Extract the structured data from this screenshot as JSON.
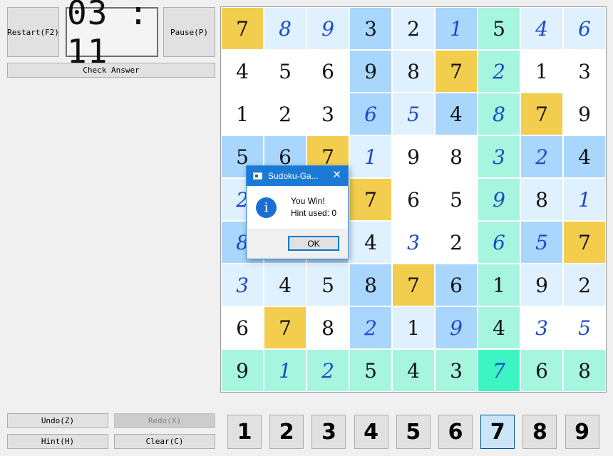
{
  "toolbar": {
    "restart_label": "Restart(F2)",
    "pause_label": "Pause(P)",
    "check_label": "Check Answer",
    "timer": "03 : 11"
  },
  "actions": {
    "undo_label": "Undo(Z)",
    "redo_label": "Redo(X)",
    "hint_label": "Hint(H)",
    "clear_label": "Clear(C)"
  },
  "board": {
    "rows": [
      [
        {
          "v": "7",
          "bg": "#f2cd4e",
          "u": 0
        },
        {
          "v": "8",
          "bg": "#dff0ff",
          "u": 1
        },
        {
          "v": "9",
          "bg": "#dff0ff",
          "u": 1
        },
        {
          "v": "3",
          "bg": "#a8d6fc",
          "u": 0
        },
        {
          "v": "2",
          "bg": "#dff0ff",
          "u": 0
        },
        {
          "v": "1",
          "bg": "#a8d6fc",
          "u": 1
        },
        {
          "v": "5",
          "bg": "#a6f5de",
          "u": 0
        },
        {
          "v": "4",
          "bg": "#dff0ff",
          "u": 1
        },
        {
          "v": "6",
          "bg": "#dff0ff",
          "u": 1
        }
      ],
      [
        {
          "v": "4",
          "bg": "#ffffff",
          "u": 0
        },
        {
          "v": "5",
          "bg": "#ffffff",
          "u": 0
        },
        {
          "v": "6",
          "bg": "#ffffff",
          "u": 0
        },
        {
          "v": "9",
          "bg": "#a8d6fc",
          "u": 0
        },
        {
          "v": "8",
          "bg": "#dff0ff",
          "u": 0
        },
        {
          "v": "7",
          "bg": "#f2cd4e",
          "u": 0
        },
        {
          "v": "2",
          "bg": "#a6f5de",
          "u": 1
        },
        {
          "v": "1",
          "bg": "#ffffff",
          "u": 0
        },
        {
          "v": "3",
          "bg": "#ffffff",
          "u": 0
        }
      ],
      [
        {
          "v": "1",
          "bg": "#ffffff",
          "u": 0
        },
        {
          "v": "2",
          "bg": "#ffffff",
          "u": 0
        },
        {
          "v": "3",
          "bg": "#ffffff",
          "u": 0
        },
        {
          "v": "6",
          "bg": "#a8d6fc",
          "u": 1
        },
        {
          "v": "5",
          "bg": "#dff0ff",
          "u": 1
        },
        {
          "v": "4",
          "bg": "#a8d6fc",
          "u": 0
        },
        {
          "v": "8",
          "bg": "#a6f5de",
          "u": 1
        },
        {
          "v": "7",
          "bg": "#f2cd4e",
          "u": 0
        },
        {
          "v": "9",
          "bg": "#ffffff",
          "u": 0
        }
      ],
      [
        {
          "v": "5",
          "bg": "#a8d6fc",
          "u": 0
        },
        {
          "v": "6",
          "bg": "#a8d6fc",
          "u": 0
        },
        {
          "v": "7",
          "bg": "#f2cd4e",
          "u": 0
        },
        {
          "v": "1",
          "bg": "#dff0ff",
          "u": 1
        },
        {
          "v": "9",
          "bg": "#ffffff",
          "u": 0
        },
        {
          "v": "8",
          "bg": "#ffffff",
          "u": 0
        },
        {
          "v": "3",
          "bg": "#a6f5de",
          "u": 1
        },
        {
          "v": "2",
          "bg": "#a8d6fc",
          "u": 1
        },
        {
          "v": "4",
          "bg": "#a8d6fc",
          "u": 0
        }
      ],
      [
        {
          "v": "2",
          "bg": "#dff0ff",
          "u": 1
        },
        {
          "v": "",
          "bg": "#dff0ff",
          "u": 0
        },
        {
          "v": "",
          "bg": "#dff0ff",
          "u": 0
        },
        {
          "v": "7",
          "bg": "#f2cd4e",
          "u": 0
        },
        {
          "v": "6",
          "bg": "#ffffff",
          "u": 0
        },
        {
          "v": "5",
          "bg": "#ffffff",
          "u": 0
        },
        {
          "v": "9",
          "bg": "#a6f5de",
          "u": 1
        },
        {
          "v": "8",
          "bg": "#dff0ff",
          "u": 0
        },
        {
          "v": "1",
          "bg": "#dff0ff",
          "u": 1
        }
      ],
      [
        {
          "v": "8",
          "bg": "#a8d6fc",
          "u": 1
        },
        {
          "v": "",
          "bg": "#a8d6fc",
          "u": 0
        },
        {
          "v": "",
          "bg": "#a8d6fc",
          "u": 0
        },
        {
          "v": "4",
          "bg": "#dff0ff",
          "u": 0
        },
        {
          "v": "3",
          "bg": "#ffffff",
          "u": 1
        },
        {
          "v": "2",
          "bg": "#ffffff",
          "u": 0
        },
        {
          "v": "6",
          "bg": "#a6f5de",
          "u": 1
        },
        {
          "v": "5",
          "bg": "#a8d6fc",
          "u": 1
        },
        {
          "v": "7",
          "bg": "#f2cd4e",
          "u": 0
        }
      ],
      [
        {
          "v": "3",
          "bg": "#dff0ff",
          "u": 1
        },
        {
          "v": "4",
          "bg": "#dff0ff",
          "u": 0
        },
        {
          "v": "5",
          "bg": "#dff0ff",
          "u": 0
        },
        {
          "v": "8",
          "bg": "#a8d6fc",
          "u": 0
        },
        {
          "v": "7",
          "bg": "#f2cd4e",
          "u": 0
        },
        {
          "v": "6",
          "bg": "#a8d6fc",
          "u": 0
        },
        {
          "v": "1",
          "bg": "#a6f5de",
          "u": 0
        },
        {
          "v": "9",
          "bg": "#dff0ff",
          "u": 0
        },
        {
          "v": "2",
          "bg": "#dff0ff",
          "u": 0
        }
      ],
      [
        {
          "v": "6",
          "bg": "#ffffff",
          "u": 0
        },
        {
          "v": "7",
          "bg": "#f2cd4e",
          "u": 0
        },
        {
          "v": "8",
          "bg": "#ffffff",
          "u": 0
        },
        {
          "v": "2",
          "bg": "#a8d6fc",
          "u": 1
        },
        {
          "v": "1",
          "bg": "#dff0ff",
          "u": 0
        },
        {
          "v": "9",
          "bg": "#a8d6fc",
          "u": 1
        },
        {
          "v": "4",
          "bg": "#a6f5de",
          "u": 0
        },
        {
          "v": "3",
          "bg": "#ffffff",
          "u": 1
        },
        {
          "v": "5",
          "bg": "#ffffff",
          "u": 1
        }
      ],
      [
        {
          "v": "9",
          "bg": "#a6f5de",
          "u": 0
        },
        {
          "v": "1",
          "bg": "#a6f5de",
          "u": 1
        },
        {
          "v": "2",
          "bg": "#a6f5de",
          "u": 1
        },
        {
          "v": "5",
          "bg": "#a6f5de",
          "u": 0
        },
        {
          "v": "4",
          "bg": "#a6f5de",
          "u": 0
        },
        {
          "v": "3",
          "bg": "#a6f5de",
          "u": 0
        },
        {
          "v": "7",
          "bg": "#3df5c2",
          "u": 1
        },
        {
          "v": "6",
          "bg": "#a6f5de",
          "u": 0
        },
        {
          "v": "8",
          "bg": "#a6f5de",
          "u": 0
        }
      ]
    ]
  },
  "numpad": {
    "buttons": [
      "1",
      "2",
      "3",
      "4",
      "5",
      "6",
      "7",
      "8",
      "9"
    ],
    "selected": "7"
  },
  "dialog": {
    "title": "Sudoku-Ga...",
    "line1": "You Win!",
    "line2": "Hint used: 0",
    "ok_label": "OK"
  },
  "colors": {
    "accent": "#1a7ad6",
    "highlight_same_digit": "#f2cd4e",
    "highlight_row": "#a6f5de",
    "selected_cell": "#3df5c2",
    "user_digit": "#1c49c7"
  }
}
